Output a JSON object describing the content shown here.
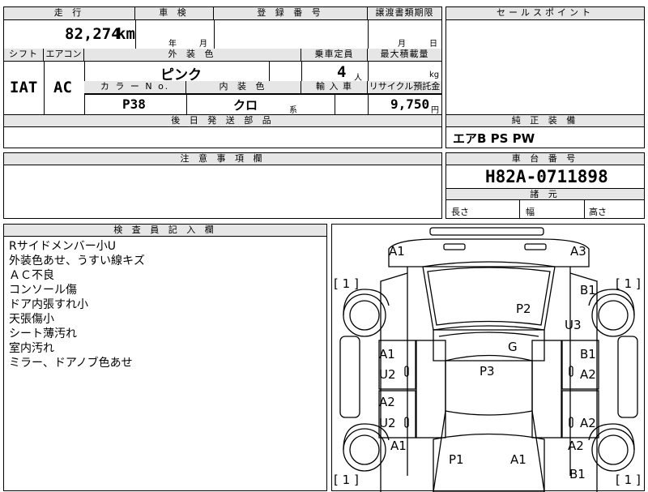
{
  "header": {
    "mileage_label": "走 行",
    "inspection_label": "車 検",
    "registration_label": "登 録 番 号",
    "transfer_docs_label": "譲渡書類期限",
    "sales_point_label": "セールスポイント"
  },
  "mileage": {
    "value": "82,274",
    "unit": "km"
  },
  "inspection": {
    "year_unit": "年",
    "month_unit": "月"
  },
  "transfer_docs": {
    "month_unit": "月",
    "day_unit": "日"
  },
  "row2": {
    "shift_label": "シフト",
    "ac_label": "エアコン",
    "ext_color_label": "外 装 色",
    "capacity_label": "乗車定員",
    "max_load_label": "最大積載量",
    "shift_value": "IAT",
    "ac_value": "AC",
    "ext_color_value": "ピンク",
    "capacity_value": "4",
    "capacity_unit": "人",
    "max_load_unit": "kg",
    "color_no_label": "カ ラ ー N o.",
    "interior_color_label": "内 装 色",
    "import_label": "輸 入 車",
    "recycle_label": "リサイクル預託金",
    "color_no_value": "P38",
    "interior_color_value": "クロ",
    "interior_suffix": "系",
    "recycle_value": "9,750",
    "recycle_unit": "円"
  },
  "later_parts_label": "後 日 発 送 部 品",
  "equipment": {
    "label": "純 正 装 備",
    "value": "エアB PS PW"
  },
  "caution_label": "注 意 事 項 欄",
  "chassis": {
    "label": "車 台 番 号",
    "value": "H82A-0711898",
    "dimensions_label": "諸 元",
    "length_label": "長さ",
    "width_label": "幅",
    "height_label": "高さ"
  },
  "inspector": {
    "label": "検 査 員 記 入 欄",
    "notes": [
      "Rサイドメンバー小U",
      "外装色あせ、うすい線キズ",
      "ＡＣ不良",
      "コンソール傷",
      "ドア内張すれ小",
      "天張傷小",
      "シート薄汚れ",
      "室内汚れ",
      "ミラー、ドアノブ色あせ"
    ]
  },
  "diagram": {
    "bracket_values": [
      "1",
      "1",
      "1",
      "1"
    ],
    "marks": {
      "front_left": "A1",
      "front_right": "A3",
      "right_fender": "B1",
      "windshield": "P2",
      "right_roof": "U3",
      "roof": "G",
      "right_front_door": "B1",
      "right_front_door_2": "A2",
      "left_front_door": "A1",
      "left_front_door_2": "U2",
      "center": "P3",
      "left_rear_door": "A2",
      "left_rear_door_2": "U2",
      "right_rear_door": "A2",
      "left_quarter": "A1",
      "right_quarter": "A2",
      "rear_glass": "P1",
      "rear_glass_2": "A1",
      "rear_right": "B1"
    }
  }
}
